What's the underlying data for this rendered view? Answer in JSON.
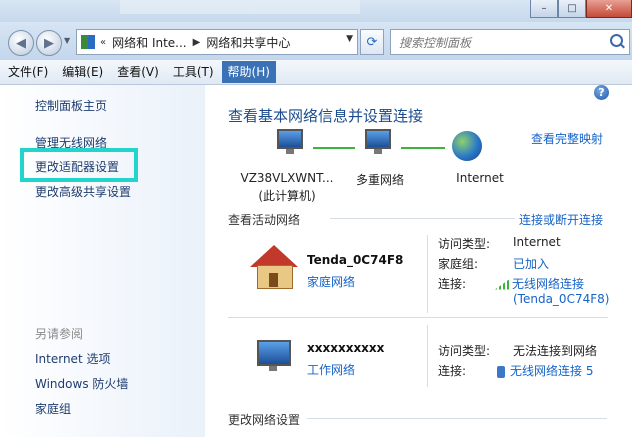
{
  "window": {
    "minimize": "–",
    "maximize": "□",
    "close": "✕"
  },
  "address": {
    "crumbs": [
      "网络和 Inte...",
      "网络和共享中心"
    ]
  },
  "search": {
    "placeholder": "搜索控制面板"
  },
  "menu": [
    "文件(F)",
    "编辑(E)",
    "查看(V)",
    "工具(T)",
    "帮助(H)"
  ],
  "left": {
    "links": [
      "控制面板主页",
      "管理无线网络",
      "更改适配器设置",
      "更改高级共享设置"
    ],
    "see_also_title": "另请参阅",
    "see_also": [
      "Internet 选项",
      "Windows 防火墙",
      "家庭组"
    ]
  },
  "main": {
    "title": "查看基本网络信息并设置连接",
    "full_map": "查看完整映射",
    "map": {
      "computer": "VZ38VLXWNT...",
      "computer_sub": "(此计算机)",
      "multi": "多重网络",
      "internet": "Internet"
    },
    "active_title": "查看活动网络",
    "connect_link": "连接或断开连接",
    "networks": [
      {
        "name": "Tenda_0C74F8",
        "type": "家庭网络",
        "access_k": "访问类型:",
        "access_v": "Internet",
        "hg_k": "家庭组:",
        "hg_v": "已加入",
        "conn_k": "连接:",
        "conn_v": "无线网络连接",
        "conn_v2": "(Tenda_0C74F8)"
      },
      {
        "name": "xxxxxxxxxx",
        "type": "工作网络",
        "access_k": "访问类型:",
        "access_v": "无法连接到网络",
        "conn_k": "连接:",
        "conn_v": "无线网络连接 5"
      }
    ],
    "change_title": "更改网络设置"
  },
  "colors": {
    "accent": "#3b72b6",
    "highlight": "#22d4cc",
    "link": "#1663c7"
  }
}
